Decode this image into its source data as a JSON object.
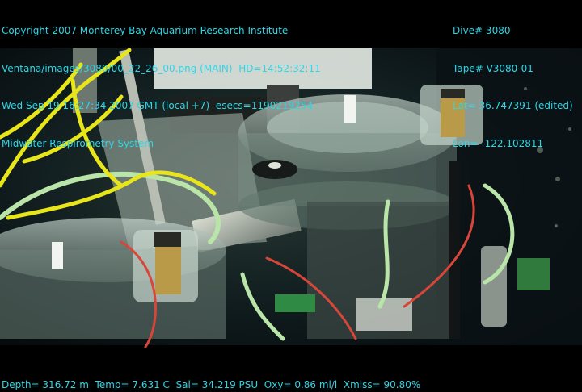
{
  "overlay": {
    "top_left": [
      "Copyright 2007 Monterey Bay Aquarium Research Institute",
      "Ventana/images/3080/00_22_26_00.png (MAIN)  HD=14:52:32:11",
      "Wed Sep 19 16:27:34 2007 GMT (local +7)  esecs=1190219254",
      "Midwater Respirometry System"
    ],
    "top_right": [
      "Dive# 3080",
      "Tape# V3080-01",
      "Lat= 36.747391 (edited)",
      "Lon= -122.102811"
    ],
    "bottom": "Depth= 316.72 m  Temp= 7.631 C  Sal= 34.219 PSU  Oxy= 0.86 ml/l  Xmiss= 90.80%",
    "text_color": "#2fd6e6"
  },
  "scene": {
    "description_icon": "underwater-respirometer-photo",
    "colors": {
      "water": "#0b1418",
      "rope": "#e8e61a",
      "tubing_red": "#d8463a",
      "tubing_green": "#b9e6a8",
      "acrylic": "#9fb6aa"
    }
  }
}
